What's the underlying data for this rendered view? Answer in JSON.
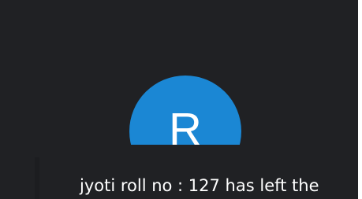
{
  "participant": {
    "avatar_letter": "R",
    "avatar_color": "#1b87d4",
    "avatar_shape": "circle"
  },
  "notification": {
    "message": "jyoti roll no : 127 has left the"
  },
  "theme": {
    "background": "#202124",
    "text_color": "#ffffff",
    "outer_border": "#ffffff"
  }
}
